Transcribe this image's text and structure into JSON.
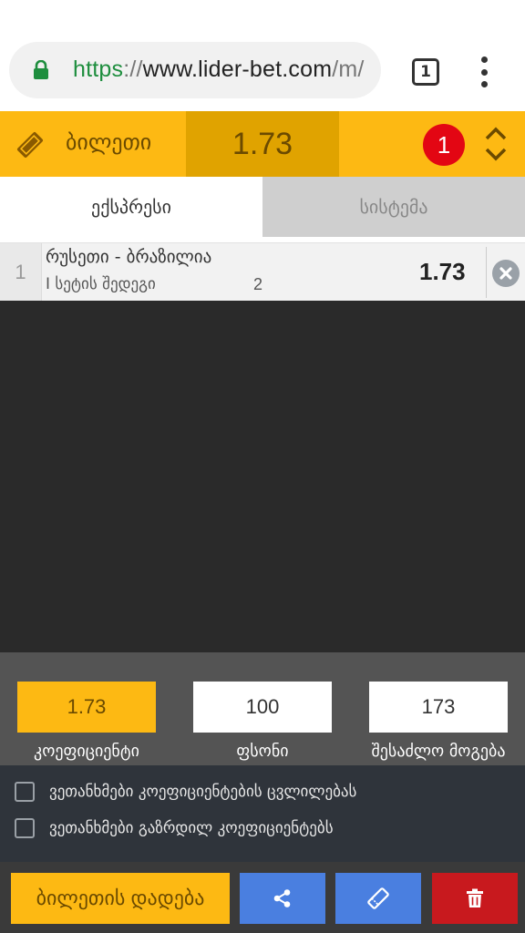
{
  "browser": {
    "url_protocol": "https",
    "url_sep": "://",
    "url_host": "www.lider-bet.com",
    "url_path": "/m/",
    "tab_count": "1"
  },
  "ticket": {
    "title": "ბილეთი",
    "total_odds": "1.73",
    "selection_count": "1"
  },
  "tabs": [
    {
      "label": "ექსპრესი",
      "active": true
    },
    {
      "label": "სისტემა",
      "active": false
    }
  ],
  "bets": [
    {
      "index": "1",
      "match": "რუსეთი - ბრაზილია",
      "market": "I სეტის შედეგი",
      "pick": "2",
      "odds": "1.73"
    }
  ],
  "summary": {
    "odds_value": "1.73",
    "odds_label": "კოეფიციენტი",
    "stake_value": "100",
    "stake_label": "ფსონი",
    "win_value": "173",
    "win_label": "შესაძლო მოგება"
  },
  "agreements": [
    {
      "label": "ვეთანხმები კოეფიციენტების ცვლილებას",
      "checked": false
    },
    {
      "label": "ვეთანხმები გაზრდილ კოეფიციენტებს",
      "checked": false
    }
  ],
  "actions": {
    "place_label": "ბილეთის დადება"
  },
  "colors": {
    "brand_yellow": "#fdb913",
    "badge_red": "#e30613",
    "action_blue": "#4a7fe0",
    "delete_red": "#c8191e"
  },
  "icons": {
    "secure": "lock-icon",
    "ticket": "ticket-icon",
    "expand": "chevron-updown-icon",
    "remove": "close-circle-icon",
    "share": "share-icon",
    "ticket_action": "ticket-icon",
    "delete": "trash-icon",
    "menu": "kebab-menu-icon"
  }
}
